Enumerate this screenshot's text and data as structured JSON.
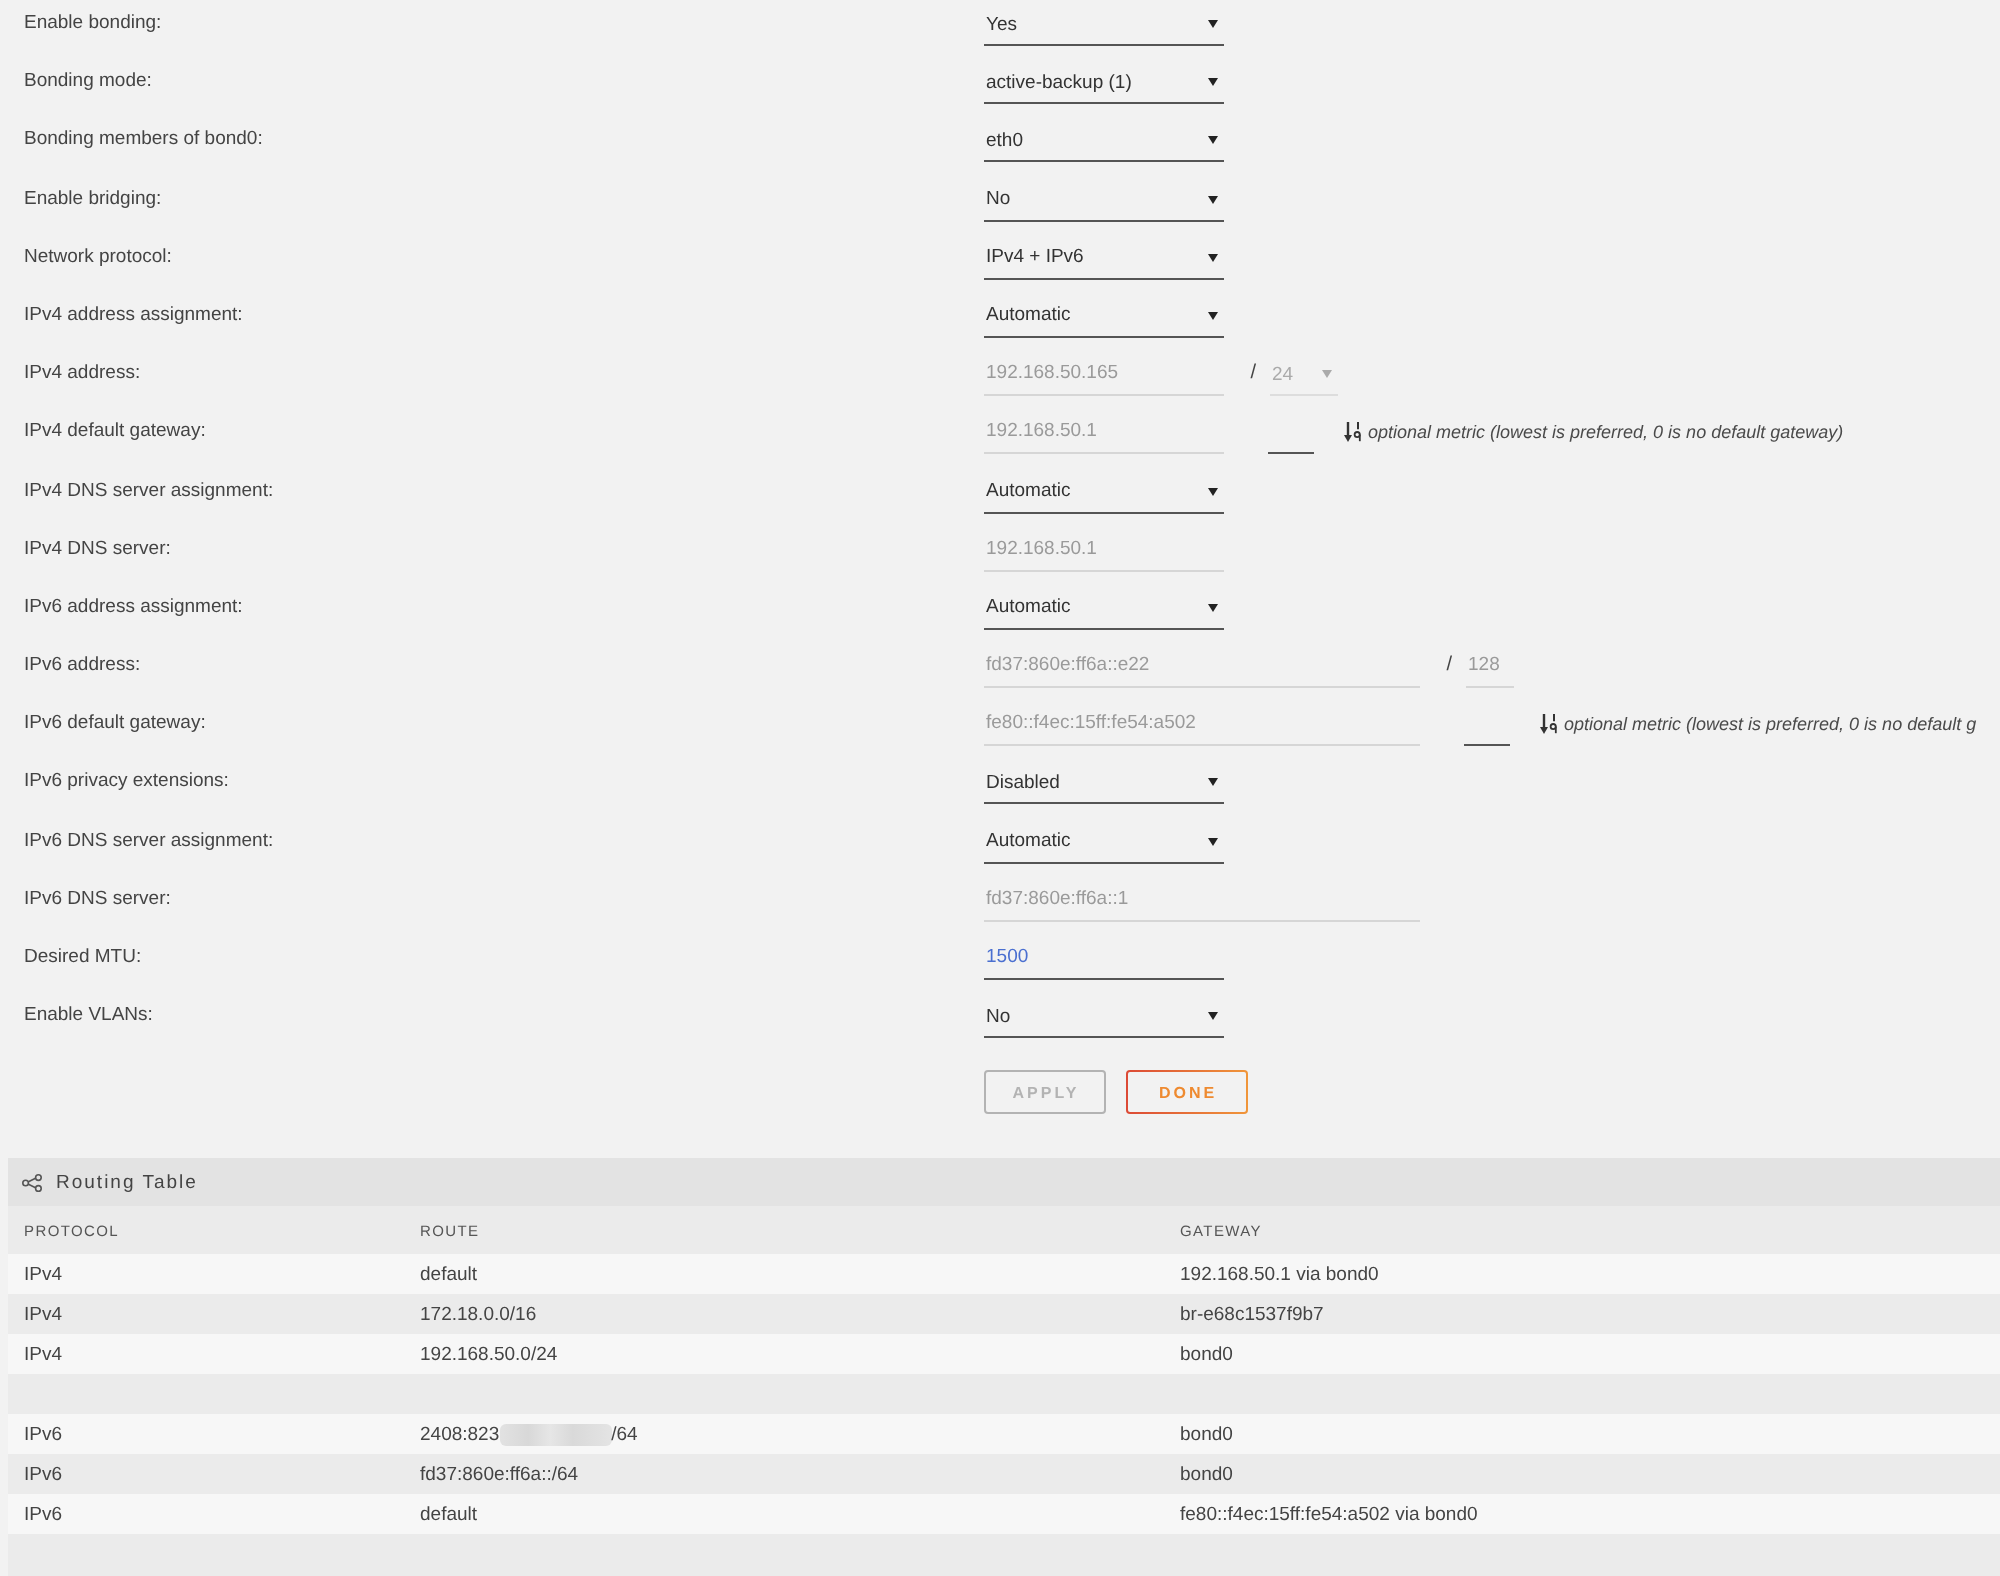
{
  "settings": [
    {
      "label": "Enable bonding:",
      "control": {
        "kind": "select",
        "value": "Yes"
      }
    },
    {
      "label": "Bonding mode:",
      "control": {
        "kind": "select",
        "value": "active-backup (1)"
      }
    },
    {
      "label": "Bonding members of bond0:",
      "control": {
        "kind": "select",
        "value": "eth0"
      }
    },
    {
      "label": "Enable bridging:",
      "control": {
        "kind": "select",
        "value": "No"
      }
    },
    {
      "label": "Network protocol:",
      "control": {
        "kind": "select",
        "value": "IPv4 + IPv6"
      }
    },
    {
      "label": "IPv4 address assignment:",
      "control": {
        "kind": "select",
        "value": "Automatic"
      }
    },
    {
      "label": "IPv4 address:",
      "control": {
        "kind": "text",
        "value": "192.168.50.165",
        "disabled": true
      },
      "separator": "/",
      "prefix": {
        "kind": "select",
        "value": "24",
        "disabled": true
      }
    },
    {
      "label": "IPv4 default gateway:",
      "control": {
        "kind": "text",
        "value": "192.168.50.1",
        "disabled": true
      },
      "metric": {
        "kind": "text",
        "disabled": false
      },
      "hint": "optional metric (lowest is preferred, 0 is no default gateway)"
    },
    {
      "label": "IPv4 DNS server assignment:",
      "control": {
        "kind": "select",
        "value": "Automatic"
      }
    },
    {
      "label": "IPv4 DNS server:",
      "control": {
        "kind": "text",
        "value": "192.168.50.1",
        "disabled": true
      }
    },
    {
      "label": "IPv6 address assignment:",
      "control": {
        "kind": "select",
        "value": "Automatic"
      }
    },
    {
      "label": "IPv6 address:",
      "control": {
        "kind": "text",
        "value": "fd37:860e:ff6a::e22",
        "disabled": true,
        "wide": true
      },
      "separator": "/",
      "prefix": {
        "kind": "text",
        "value": "128",
        "disabled": true
      }
    },
    {
      "label": "IPv6 default gateway:",
      "control": {
        "kind": "text",
        "value": "fe80::f4ec:15ff:fe54:a502",
        "disabled": true,
        "wide": true
      },
      "metric": {
        "kind": "text",
        "disabled": false
      },
      "hint": "optional metric (lowest is preferred, 0 is no default g"
    },
    {
      "label": "IPv6 privacy extensions:",
      "control": {
        "kind": "select",
        "value": "Disabled"
      }
    },
    {
      "label": "IPv6 DNS server assignment:",
      "control": {
        "kind": "select",
        "value": "Automatic"
      }
    },
    {
      "label": "IPv6 DNS server:",
      "control": {
        "kind": "text",
        "value": "fd37:860e:ff6a::1",
        "disabled": true,
        "wide": true
      }
    },
    {
      "label": "Desired MTU:",
      "control": {
        "kind": "text",
        "value": "1500",
        "disabled": false
      }
    },
    {
      "label": "Enable VLANs:",
      "control": {
        "kind": "select",
        "value": "No"
      }
    }
  ],
  "buttons": [
    {
      "label": "APPLY",
      "kind": "secondary",
      "disabled": true
    },
    {
      "label": "DONE",
      "kind": "primary",
      "disabled": false
    }
  ],
  "routing_table": {
    "title": "Routing Table",
    "columns": [
      "PROTOCOL",
      "ROUTE",
      "GATEWAY"
    ],
    "rows": [
      {
        "kind": "route",
        "protocol": "IPv4",
        "route": "default",
        "gateway": "192.168.50.1 via bond0"
      },
      {
        "kind": "route",
        "protocol": "IPv4",
        "route": "172.18.0.0/16",
        "gateway": "br-e68c1537f9b7"
      },
      {
        "kind": "route",
        "protocol": "IPv4",
        "route": "192.168.50.0/24",
        "gateway": "bond0"
      },
      {
        "kind": "spacer"
      },
      {
        "kind": "route",
        "protocol": "IPv6",
        "route": "2408:823",
        "redacted": true,
        "route_end": "/64",
        "gateway": "bond0"
      },
      {
        "kind": "route",
        "protocol": "IPv6",
        "route": "fd37:860e:ff6a::/64",
        "gateway": "bond0"
      },
      {
        "kind": "route",
        "protocol": "IPv6",
        "route": "default",
        "gateway": "fe80::f4ec:15ff:fe54:a502 via bond0"
      }
    ]
  }
}
